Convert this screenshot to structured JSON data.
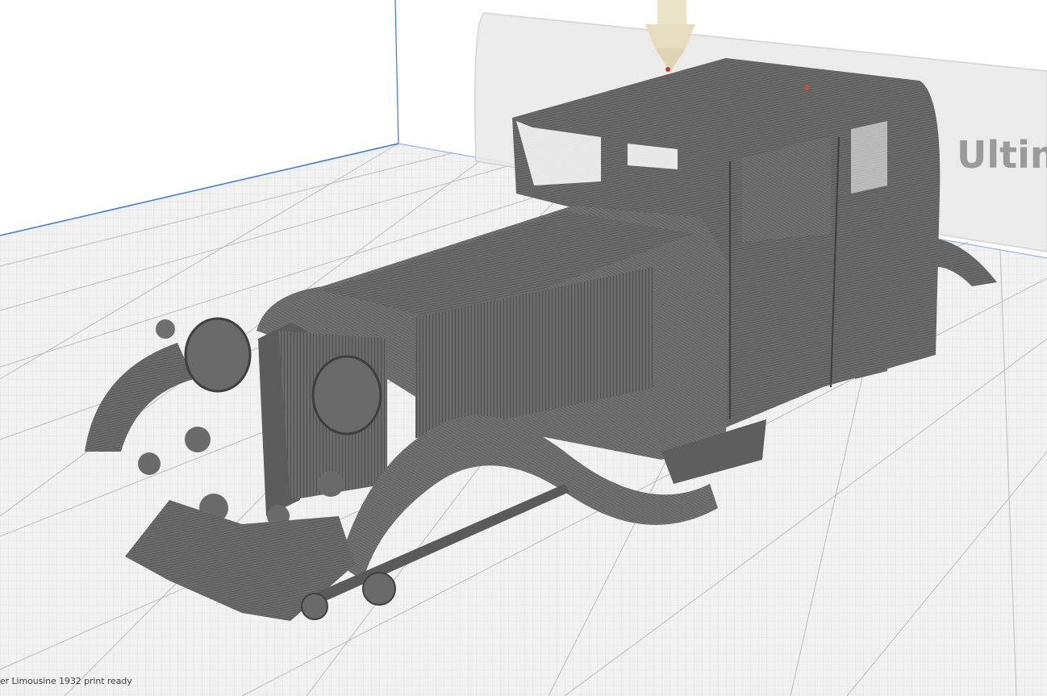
{
  "scene": {
    "printer_label": "Ultim",
    "colors": {
      "background": "#ffffff",
      "build_plate": "#f2f2f2",
      "grid_line": "#cfcfcf",
      "axis_blue": "#3a78d8",
      "model": "#6e6e6e",
      "nozzle": "#e6dcc0"
    }
  },
  "status": {
    "text": "er Limousine 1932 print ready"
  }
}
